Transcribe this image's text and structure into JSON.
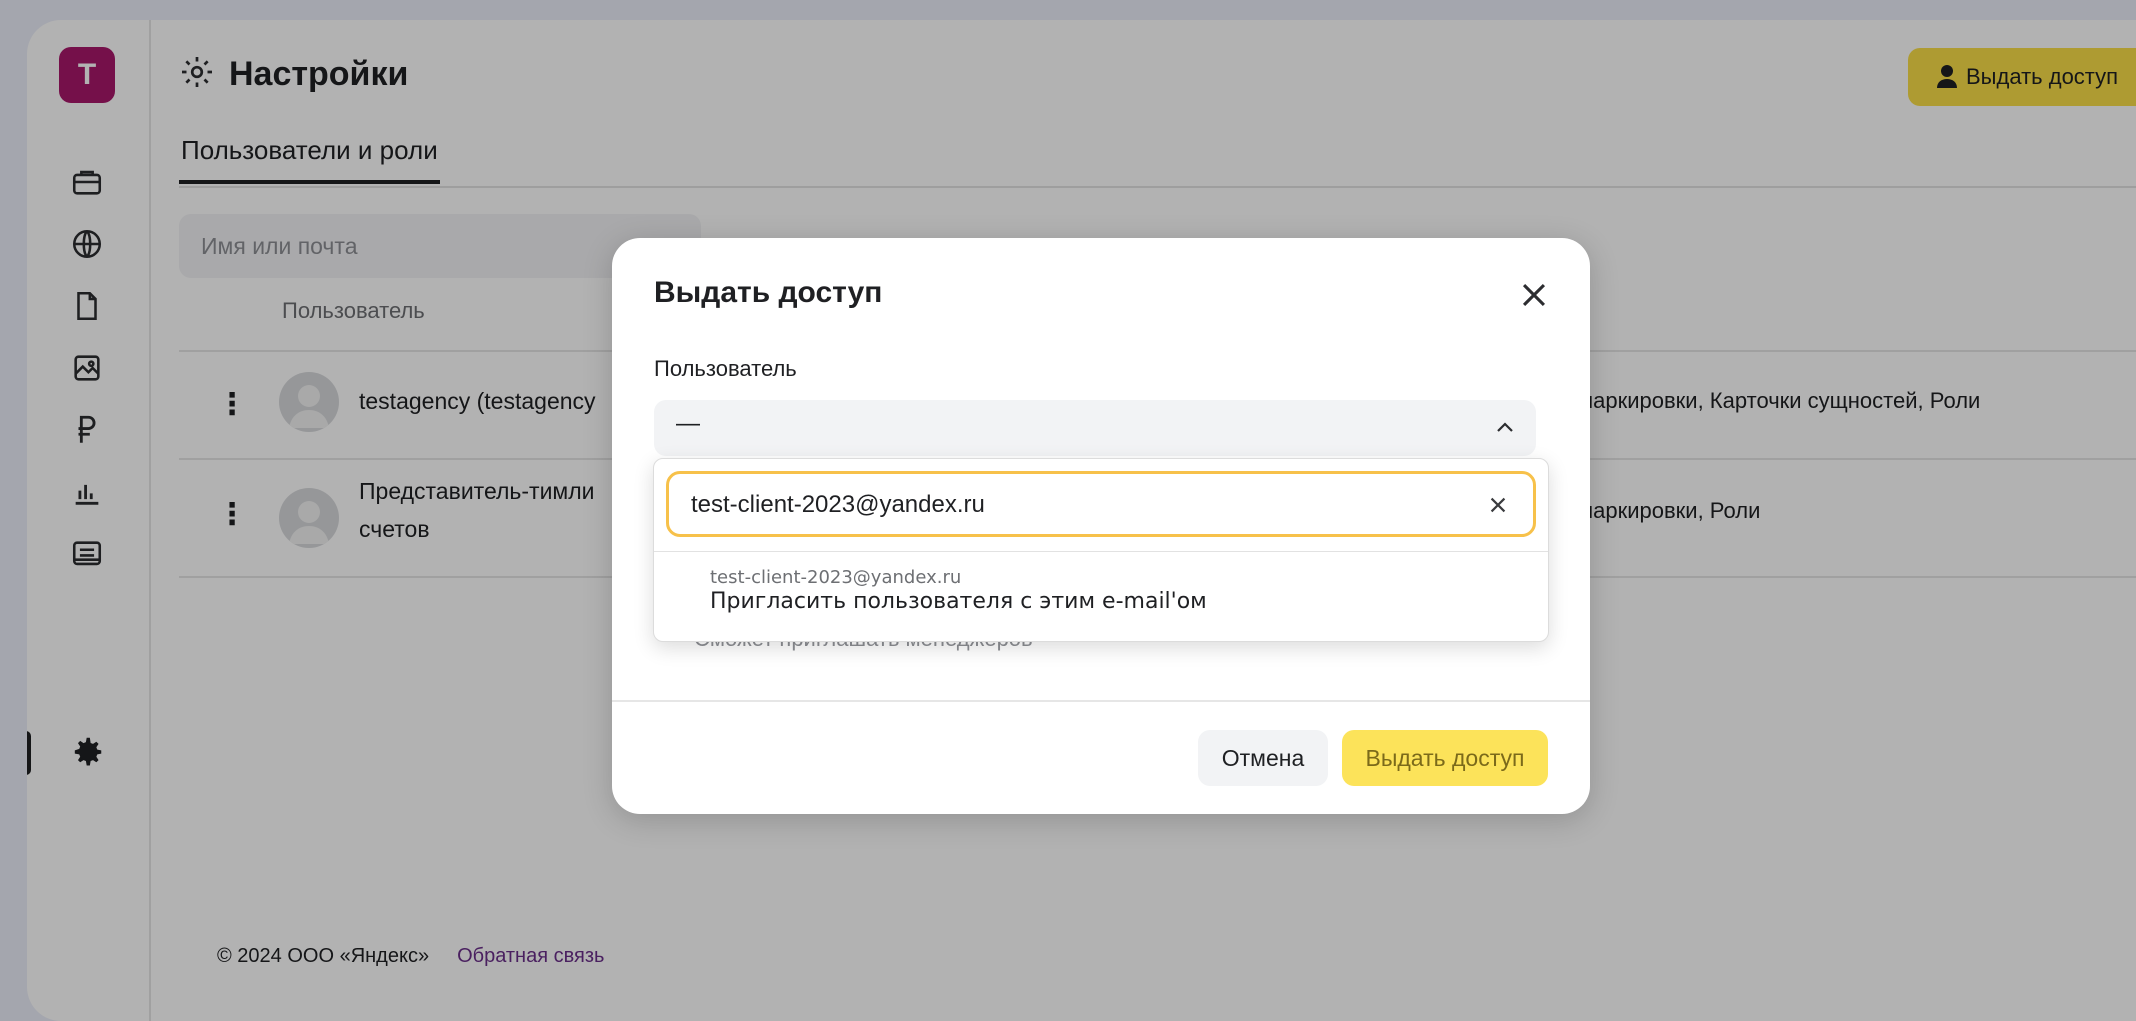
{
  "colors": {
    "accent": "#fadf48",
    "brand_avatar": "#a8176a",
    "focus_ring": "#f7c14a",
    "link": "#6b2f8a"
  },
  "sidebar": {
    "avatar_letter": "T",
    "items": [
      {
        "icon": "briefcase-icon"
      },
      {
        "icon": "globe-icon"
      },
      {
        "icon": "document-icon"
      },
      {
        "icon": "image-icon"
      },
      {
        "icon": "ruble-icon"
      },
      {
        "icon": "bar-chart-icon"
      },
      {
        "icon": "messages-icon"
      },
      {
        "icon": "gear-icon",
        "active": true
      }
    ]
  },
  "header": {
    "title": "Настройки",
    "grant_button": "Выдать доступ"
  },
  "tabs": [
    {
      "label": "Пользователи и роли",
      "active": true
    }
  ],
  "search": {
    "placeholder": "Имя или почта"
  },
  "table": {
    "col_user": "Пользователь",
    "rows": [
      {
        "name": "testagency (testagency",
        "sections": "маркировки, Карточки сущностей, Роли"
      },
      {
        "name_line1": "Представитель-тимли",
        "name_line2": "счетов",
        "sections": "маркировки, Роли"
      }
    ]
  },
  "footer": {
    "copyright": "© 2024 ООО «Яндекс»",
    "feedback": "Обратная связь"
  },
  "modal": {
    "title": "Выдать доступ",
    "user_label": "Пользователь",
    "user_value": "—",
    "hint": "Сможет приглашать менеджеров",
    "cancel": "Отмена",
    "submit": "Выдать доступ",
    "dropdown": {
      "input_value": "test-client-2023@yandex.ru",
      "option_email": "test-client-2023@yandex.ru",
      "option_action": "Пригласить пользователя с этим e-mail'ом"
    }
  }
}
